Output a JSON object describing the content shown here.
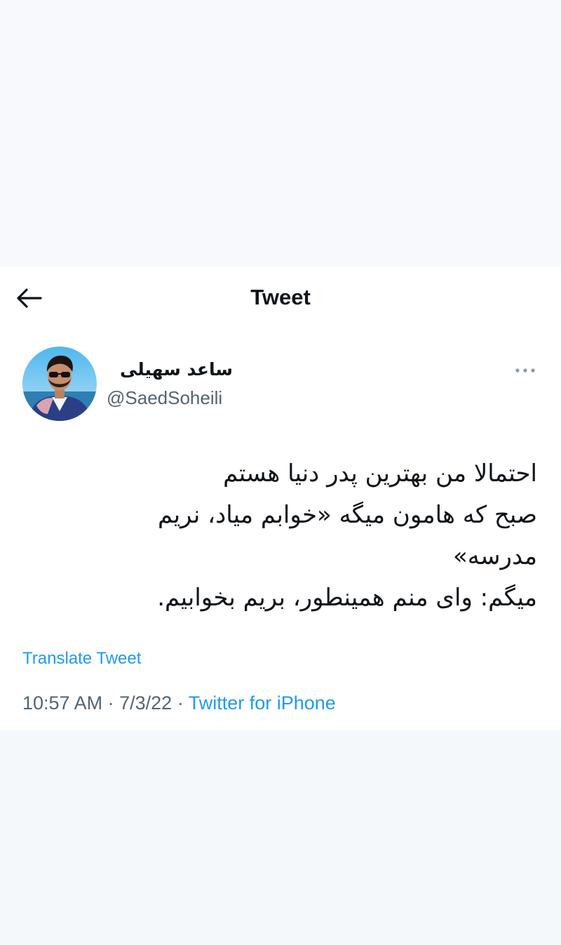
{
  "header": {
    "title": "Tweet",
    "back_icon": "arrow-left-icon"
  },
  "author": {
    "display_name": "ساعد سهیلی",
    "handle": "@SaedSoheili"
  },
  "tweet": {
    "lines": [
      "احتمالا من بهترین پدر دنیا هستم",
      "صبح که هامون میگه «خوابم میاد، نریم",
      "مدرسه»",
      "میگم: وای منم همینطور، بریم بخوابیم."
    ],
    "translate_label": "Translate Tweet",
    "time": "10:57 AM",
    "separator": "·",
    "date": "7/3/22",
    "source": "Twitter for iPhone"
  },
  "icons": {
    "more": "more-horizontal-icon"
  },
  "colors": {
    "text_primary": "#0f1419",
    "text_secondary": "#536471",
    "link": "#1d9bf0",
    "background": "#ffffff",
    "page_background": "#f7f9fc"
  }
}
